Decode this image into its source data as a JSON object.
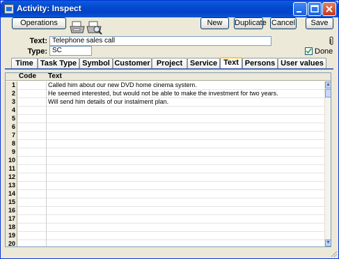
{
  "window": {
    "title": "Activity: Inspect"
  },
  "toolbar": {
    "operations": "Operations",
    "new": "New",
    "duplicate": "Duplicate",
    "cancel": "Cancel",
    "save": "Save"
  },
  "form": {
    "text_label": "Text:",
    "text_value": "Telephone sales call",
    "type_label": "Type:",
    "type_value": "SC",
    "done_label": "Done",
    "done_checked": true
  },
  "tabs": [
    "Time",
    "Task Type",
    "Symbol",
    "Customer",
    "Project",
    "Service",
    "Text",
    "Persons",
    "User values"
  ],
  "active_tab": "Text",
  "grid": {
    "columns": [
      "Code",
      "Text"
    ],
    "rows": [
      {
        "num": "1",
        "code": "",
        "text": "Called him about our new DVD home cinema system."
      },
      {
        "num": "2",
        "code": "",
        "text": "He seemed interested, but would not be able to make the investment for two years."
      },
      {
        "num": "3",
        "code": "",
        "text": "Will send him details of our instalment plan."
      },
      {
        "num": "4",
        "code": "",
        "text": ""
      },
      {
        "num": "5",
        "code": "",
        "text": ""
      },
      {
        "num": "6",
        "code": "",
        "text": ""
      },
      {
        "num": "7",
        "code": "",
        "text": ""
      },
      {
        "num": "8",
        "code": "",
        "text": ""
      },
      {
        "num": "9",
        "code": "",
        "text": ""
      },
      {
        "num": "10",
        "code": "",
        "text": ""
      },
      {
        "num": "11",
        "code": "",
        "text": ""
      },
      {
        "num": "12",
        "code": "",
        "text": ""
      },
      {
        "num": "13",
        "code": "",
        "text": ""
      },
      {
        "num": "14",
        "code": "",
        "text": ""
      },
      {
        "num": "15",
        "code": "",
        "text": ""
      },
      {
        "num": "16",
        "code": "",
        "text": ""
      },
      {
        "num": "17",
        "code": "",
        "text": ""
      },
      {
        "num": "18",
        "code": "",
        "text": ""
      },
      {
        "num": "19",
        "code": "",
        "text": ""
      },
      {
        "num": "20",
        "code": "",
        "text": ""
      }
    ]
  },
  "colors": {
    "title_bar": "#0348d1",
    "tab_highlight": "#ffc83c",
    "tab_underline": "#4d6bb8"
  }
}
